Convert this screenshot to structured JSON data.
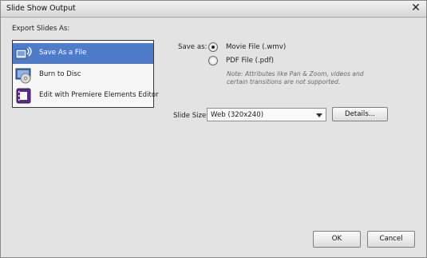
{
  "window": {
    "title": "Slide Show Output"
  },
  "export": {
    "heading": "Export Slides As:",
    "options": [
      {
        "label": "Save As a File",
        "icon": "save-file-icon",
        "selected": true
      },
      {
        "label": "Burn to Disc",
        "icon": "disc-icon",
        "selected": false
      },
      {
        "label": "Edit with Premiere Elements Editor",
        "icon": "film-icon",
        "selected": false
      }
    ]
  },
  "save_as": {
    "label": "Save as:",
    "movie_label": "Movie File (.wmv)",
    "pdf_label": "PDF File (.pdf)",
    "selected": "movie",
    "note": "Note:  Attributes like Pan & Zoom, videos and certain transitions are not supported."
  },
  "slide_size": {
    "label": "Slide Size:",
    "value": "Web (320x240)",
    "details_label": "Details..."
  },
  "buttons": {
    "ok": "OK",
    "cancel": "Cancel"
  },
  "colors": {
    "selection": "#4f7cc8"
  }
}
